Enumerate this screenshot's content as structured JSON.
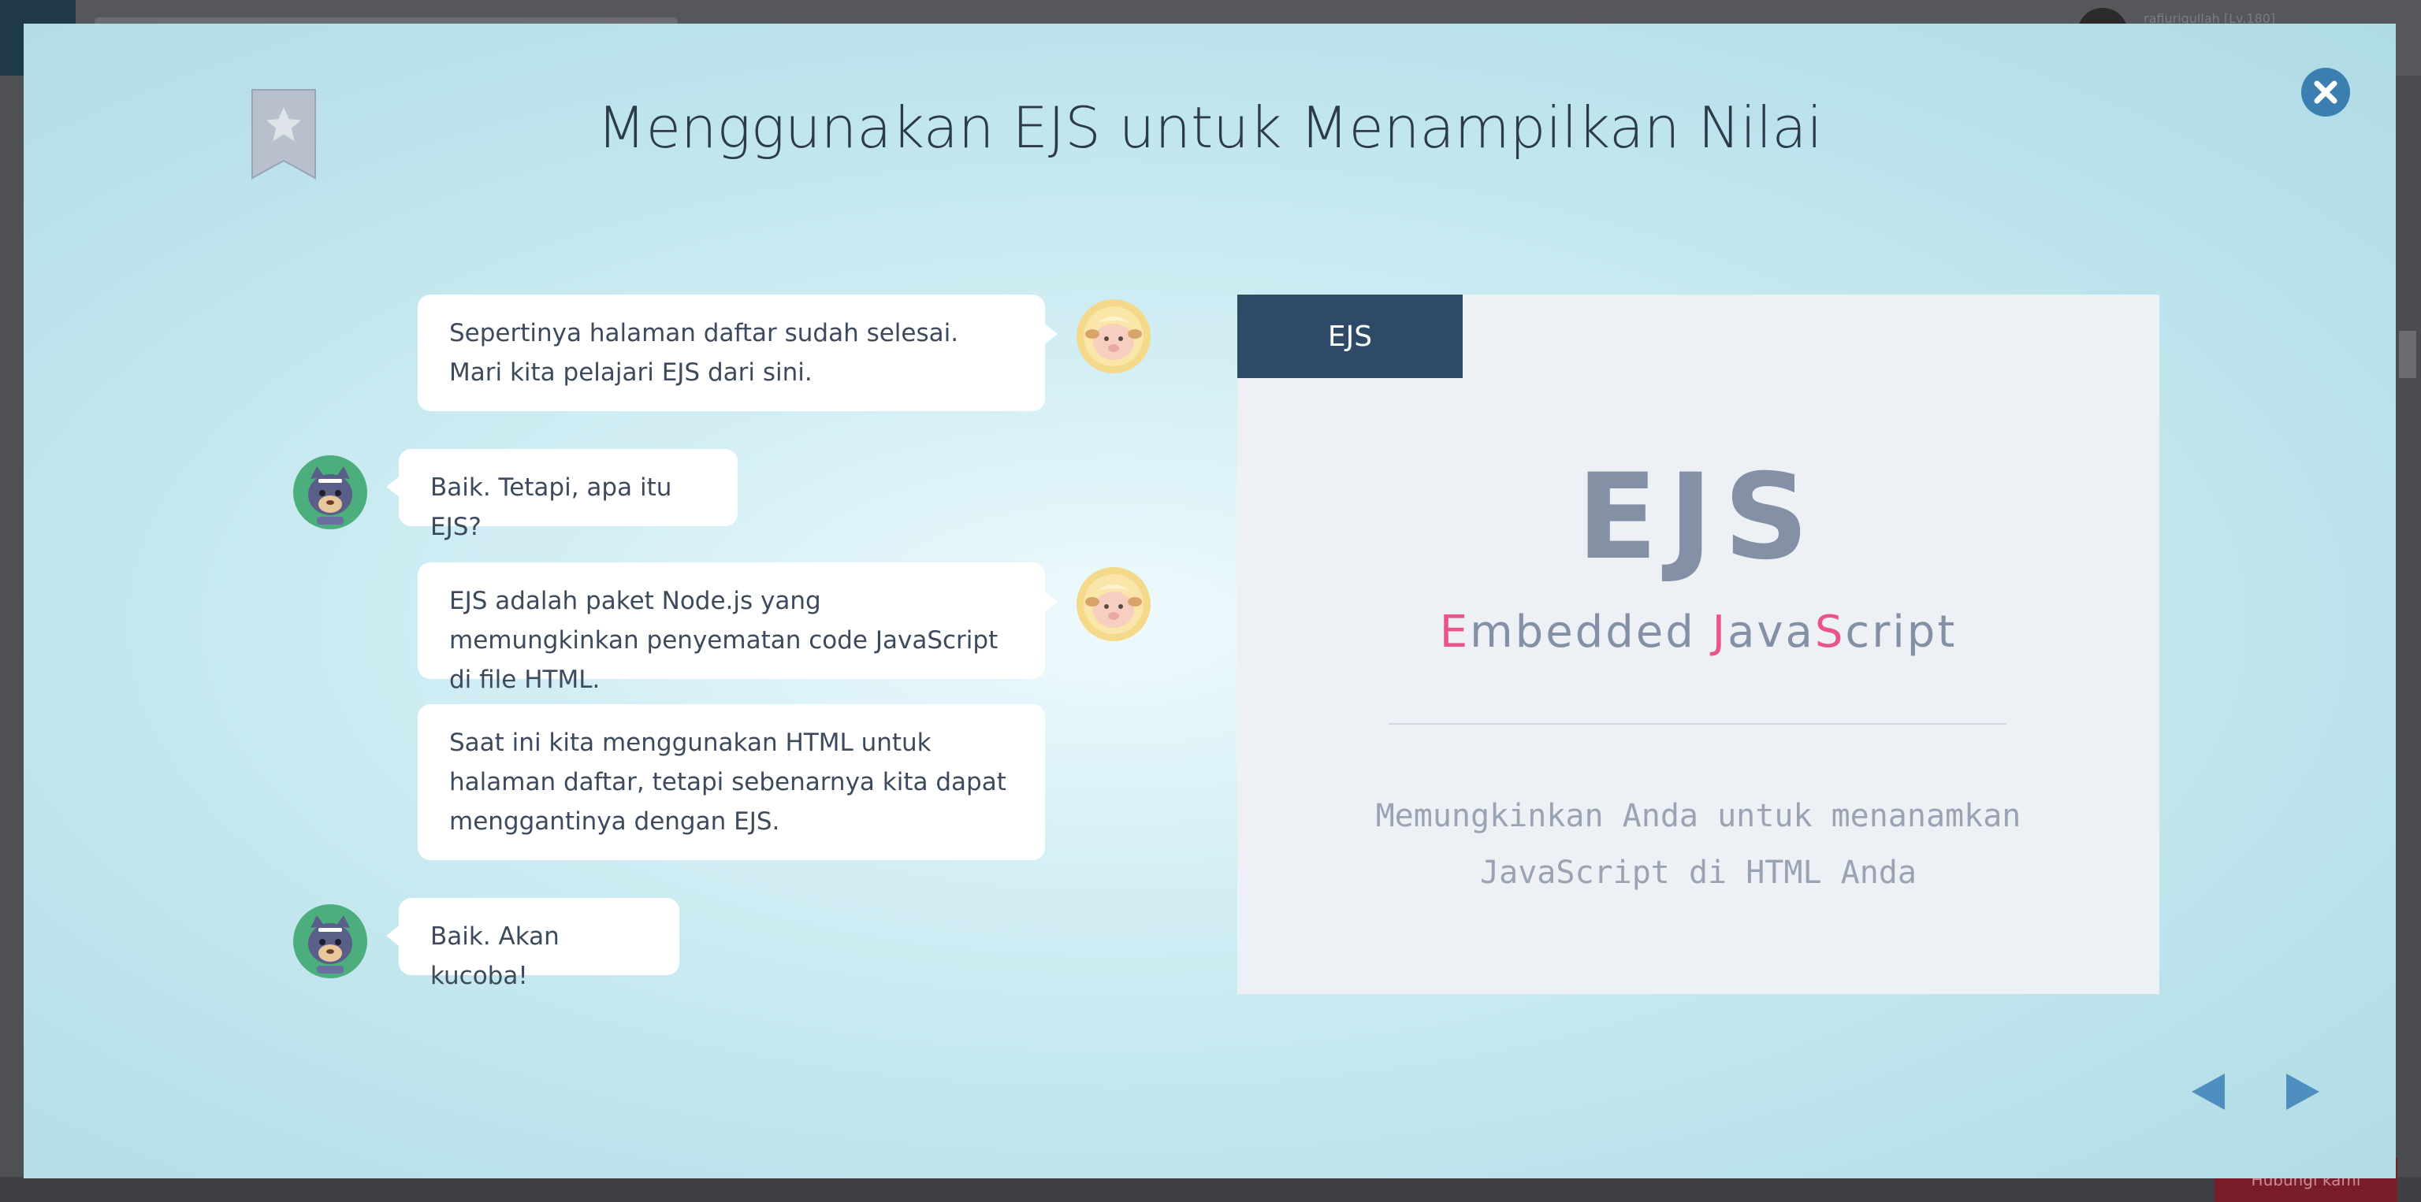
{
  "background": {
    "user_name": "rafiuriqullah [Lv.180]",
    "cta_label": "Hubungi kami"
  },
  "lesson": {
    "title": "Menggunakan EJS untuk Menampilkan Nilai"
  },
  "chat": [
    {
      "speaker": "sheep",
      "text": "Sepertinya halaman daftar sudah selesai. Mari kita pelajari EJS dari sini."
    },
    {
      "speaker": "cat",
      "text": "Baik. Tetapi, apa itu EJS?"
    },
    {
      "speaker": "sheep",
      "text": "EJS adalah paket Node.js yang memungkinkan penyematan code JavaScript di file HTML."
    },
    {
      "speaker": "sheep",
      "text": "Saat ini kita menggunakan HTML untuk halaman daftar, tetapi sebenarnya kita dapat menggantinya dengan EJS."
    },
    {
      "speaker": "cat",
      "text": "Baik. Akan kucoba!"
    }
  ],
  "slide": {
    "tab_label": "EJS",
    "logo": "EJS",
    "subtitle_parts": [
      "E",
      "mbedded ",
      "J",
      "ava",
      "S",
      "cript"
    ],
    "description_line1": "Memungkinkan Anda untuk menanamkan",
    "description_line2": "JavaScript di HTML Anda"
  },
  "icons": {
    "bookmark": "star-bookmark-icon",
    "close": "close-icon",
    "prev": "prev-arrow-icon",
    "next": "next-arrow-icon"
  },
  "colors": {
    "accent_blue": "#3a7fb0",
    "tab_navy": "#2f4a66",
    "highlight_pink": "#e9558a"
  }
}
